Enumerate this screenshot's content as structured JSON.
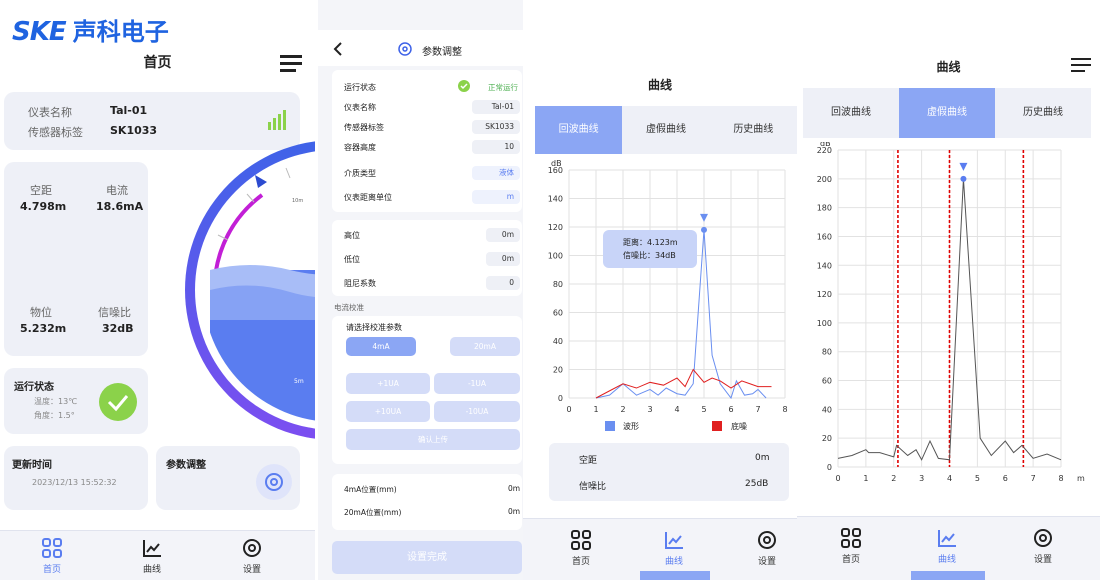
{
  "brand": {
    "logo_text": "SKE",
    "company": "声科电子",
    "color": "#1f63e0"
  },
  "colors": {
    "accent": "#5a7df0",
    "green": "#8bd24a",
    "wave": "#6a8ff0",
    "noise": "#e02020",
    "gate": "#e00000",
    "purple": "#c21fd6"
  },
  "home": {
    "title": "首页",
    "info": {
      "name_label": "仪表名称",
      "name_value": "Tal-01",
      "tag_label": "传感器标签",
      "tag_value": "SK1033"
    },
    "stats": {
      "empty_label": "空距",
      "empty_value": "4.798m",
      "current_label": "电流",
      "current_value": "18.6mA",
      "level_label": "物位",
      "level_value": "5.232m",
      "snr_label": "信噪比",
      "snr_value": "32dB"
    },
    "gauge": {
      "marker_1": "10m",
      "marker_2": "5m",
      "fill_fraction": 0.5
    },
    "status": {
      "title": "运行状态",
      "temp": "温度：13℃",
      "angle": "角度：1.5°"
    },
    "update": {
      "title": "更新时间",
      "time": "2023/12/13 15:52:32"
    },
    "params": {
      "title": "参数调整"
    }
  },
  "params": {
    "title": "参数调整",
    "rows": [
      {
        "label": "运行状态",
        "value": "正常运行"
      },
      {
        "label": "仪表名称",
        "value": "Tal-01"
      },
      {
        "label": "传感器标签",
        "value": "SK1033"
      },
      {
        "label": "容器高度",
        "value": "10"
      },
      {
        "label": "介质类型",
        "value": "液体"
      },
      {
        "label": "仪表距离单位",
        "value": "m"
      }
    ],
    "rows2": [
      {
        "label": "高位",
        "value": "0m"
      },
      {
        "label": "低位",
        "value": "0m"
      },
      {
        "label": "阻尼系数",
        "value": "0"
      }
    ],
    "calib_header": "电流校准",
    "calib_prompt": "请选择校准参数",
    "btn_4ma": "4mA",
    "btn_20ma": "20mA",
    "btn_p1": "+1UA",
    "btn_m1": "-1UA",
    "btn_p10": "+10UA",
    "btn_m10": "-10UA",
    "btn_confirm": "确认上传",
    "pos_4ma_label": "4mA位置(mm)",
    "pos_4ma_value": "0m",
    "pos_20ma_label": "20mA位置(mm)",
    "pos_20ma_value": "0m",
    "btn_done": "设置完成"
  },
  "curve1": {
    "title": "曲线",
    "tabs": [
      "回波曲线",
      "虚假曲线",
      "历史曲线"
    ],
    "tooltip_distance": "距离：4.123m",
    "tooltip_snr": "信噪比：34dB",
    "legend_wave": "波形",
    "legend_noise": "底噪",
    "empty_label": "空距",
    "empty_value": "0m",
    "snr_label": "信噪比",
    "snr_value": "25dB"
  },
  "curve2": {
    "title": "曲线",
    "tabs": [
      "回波曲线",
      "虚假曲线",
      "历史曲线"
    ]
  },
  "nav": {
    "home": "首页",
    "curve": "曲线",
    "settings": "设置"
  },
  "chart_data": [
    {
      "type": "line",
      "ylabel": "dB",
      "xlim": [
        0,
        8
      ],
      "ylim": [
        0,
        160
      ],
      "x_ticks": [
        0,
        1,
        2,
        3,
        4,
        5,
        6,
        7,
        8
      ],
      "y_ticks": [
        0,
        20,
        40,
        60,
        80,
        100,
        120,
        140,
        160
      ],
      "grid": true,
      "legend": "bottom",
      "series": [
        {
          "name": "波形",
          "x": [
            1,
            1.5,
            2,
            2.5,
            3,
            3.3,
            3.6,
            4,
            4.3,
            4.6,
            5,
            5.3,
            5.6,
            6,
            6.2,
            6.5,
            6.8,
            7,
            7.3
          ],
          "values": [
            0,
            2,
            10,
            2,
            6,
            2,
            7,
            3,
            2,
            10,
            118,
            30,
            10,
            0,
            12,
            2,
            3,
            6,
            0
          ]
        },
        {
          "name": "底噪",
          "x": [
            1,
            1.5,
            2,
            2.5,
            3,
            3.5,
            4,
            4.3,
            4.6,
            5,
            5.3,
            5.6,
            6,
            6.4,
            6.7,
            7,
            7.5
          ],
          "values": [
            0,
            5,
            10,
            7,
            11,
            9,
            14,
            8,
            20,
            11,
            14,
            12,
            7,
            12,
            10,
            8,
            8
          ]
        },
        {
          "name": "",
          "x": [
            5
          ],
          "values": [
            118
          ]
        }
      ]
    },
    {
      "type": "line",
      "ylabel": "dB",
      "xunit": "m",
      "xlim": [
        0,
        8
      ],
      "ylim": [
        0,
        220
      ],
      "x_ticks": [
        0,
        1,
        2,
        3,
        4,
        5,
        6,
        7,
        8
      ],
      "y_ticks": [
        0,
        20,
        40,
        60,
        80,
        100,
        120,
        140,
        160,
        180,
        200,
        220
      ],
      "grid": true,
      "gates": [
        2.15,
        4.0,
        6.65
      ],
      "series": [
        {
          "name": "",
          "x": [
            0,
            0.5,
            1,
            1.1,
            1.5,
            2,
            2.1,
            2.5,
            2.8,
            3.0,
            3.3,
            3.6,
            4,
            4.5,
            5.1,
            5.5,
            6,
            6.3,
            6.6,
            7,
            7.5,
            8
          ],
          "values": [
            6,
            8,
            12,
            10,
            10,
            7,
            15,
            8,
            12,
            5,
            18,
            6,
            5,
            200,
            20,
            8,
            18,
            10,
            15,
            6,
            9,
            5
          ]
        },
        {
          "name": "",
          "x": [
            4.5
          ],
          "values": [
            200
          ]
        }
      ]
    }
  ]
}
